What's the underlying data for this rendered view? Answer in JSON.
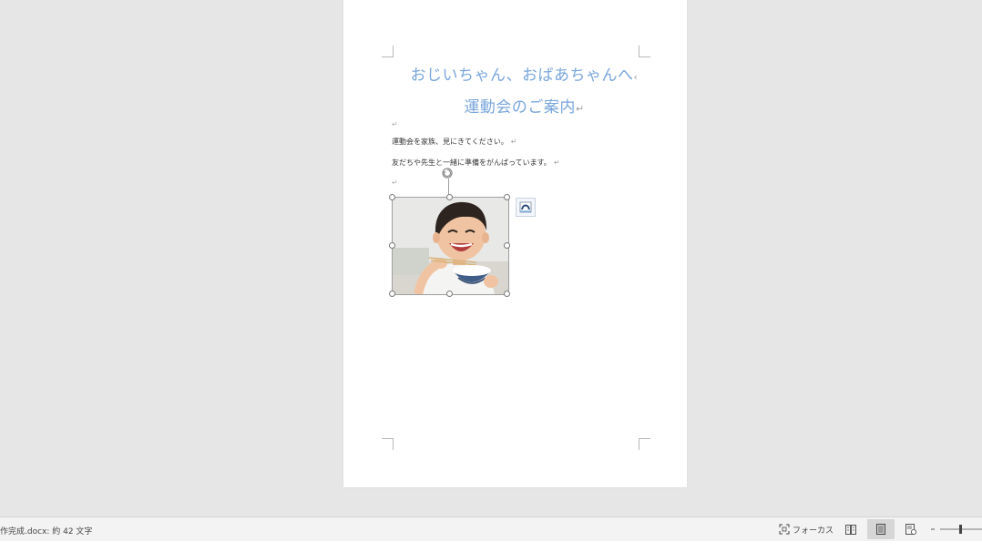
{
  "document": {
    "title_line1": "おじいちゃん、おばあちゃんへ",
    "title_line2": "運動会のご案内",
    "paragraph1": "運動会を家族、見にきてください。",
    "paragraph2": "友だちや先生と一緒に準備をがんばっています。",
    "return_mark": "↵",
    "title1_mark": "‹",
    "empty_mark": "↵"
  },
  "image": {
    "description_icon": "photo-child-eating-rice"
  },
  "status_bar": {
    "doc_info": "作完成.docx: 約 42 文字",
    "focus_label": "フォーカス",
    "views": [
      "read-mode-icon",
      "print-layout-icon",
      "web-layout-icon"
    ],
    "active_view": "print-layout-icon"
  },
  "colors": {
    "title": "#79a6dc",
    "background": "#e6e6e6",
    "page": "#ffffff",
    "statusbar": "#f3f3f3"
  }
}
